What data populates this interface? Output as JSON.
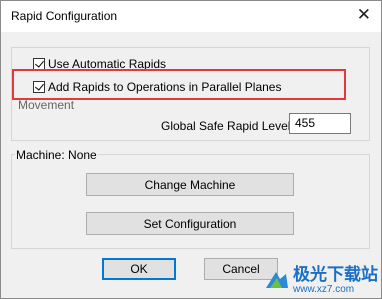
{
  "window": {
    "title": "Rapid Configuration"
  },
  "options": {
    "use_automatic_rapids": {
      "label": "Use Automatic Rapids",
      "checked": true
    },
    "add_rapids_parallel": {
      "label": "Add Rapids to Operations in Parallel Planes",
      "checked": true
    }
  },
  "movement": {
    "label": "Movement",
    "safe_rapid_label": "Global Safe Rapid Level",
    "safe_rapid_value": "455"
  },
  "machine": {
    "label": "Machine: None",
    "change_button": "Change Machine",
    "set_config_button": "Set Configuration"
  },
  "footer": {
    "ok": "OK",
    "cancel": "Cancel"
  },
  "watermark": {
    "text": "极光下载站",
    "url": "www.xz7.com"
  },
  "colors": {
    "highlight": "#e2393a",
    "accent": "#0078d7",
    "watermark": "#1b6fc4"
  }
}
